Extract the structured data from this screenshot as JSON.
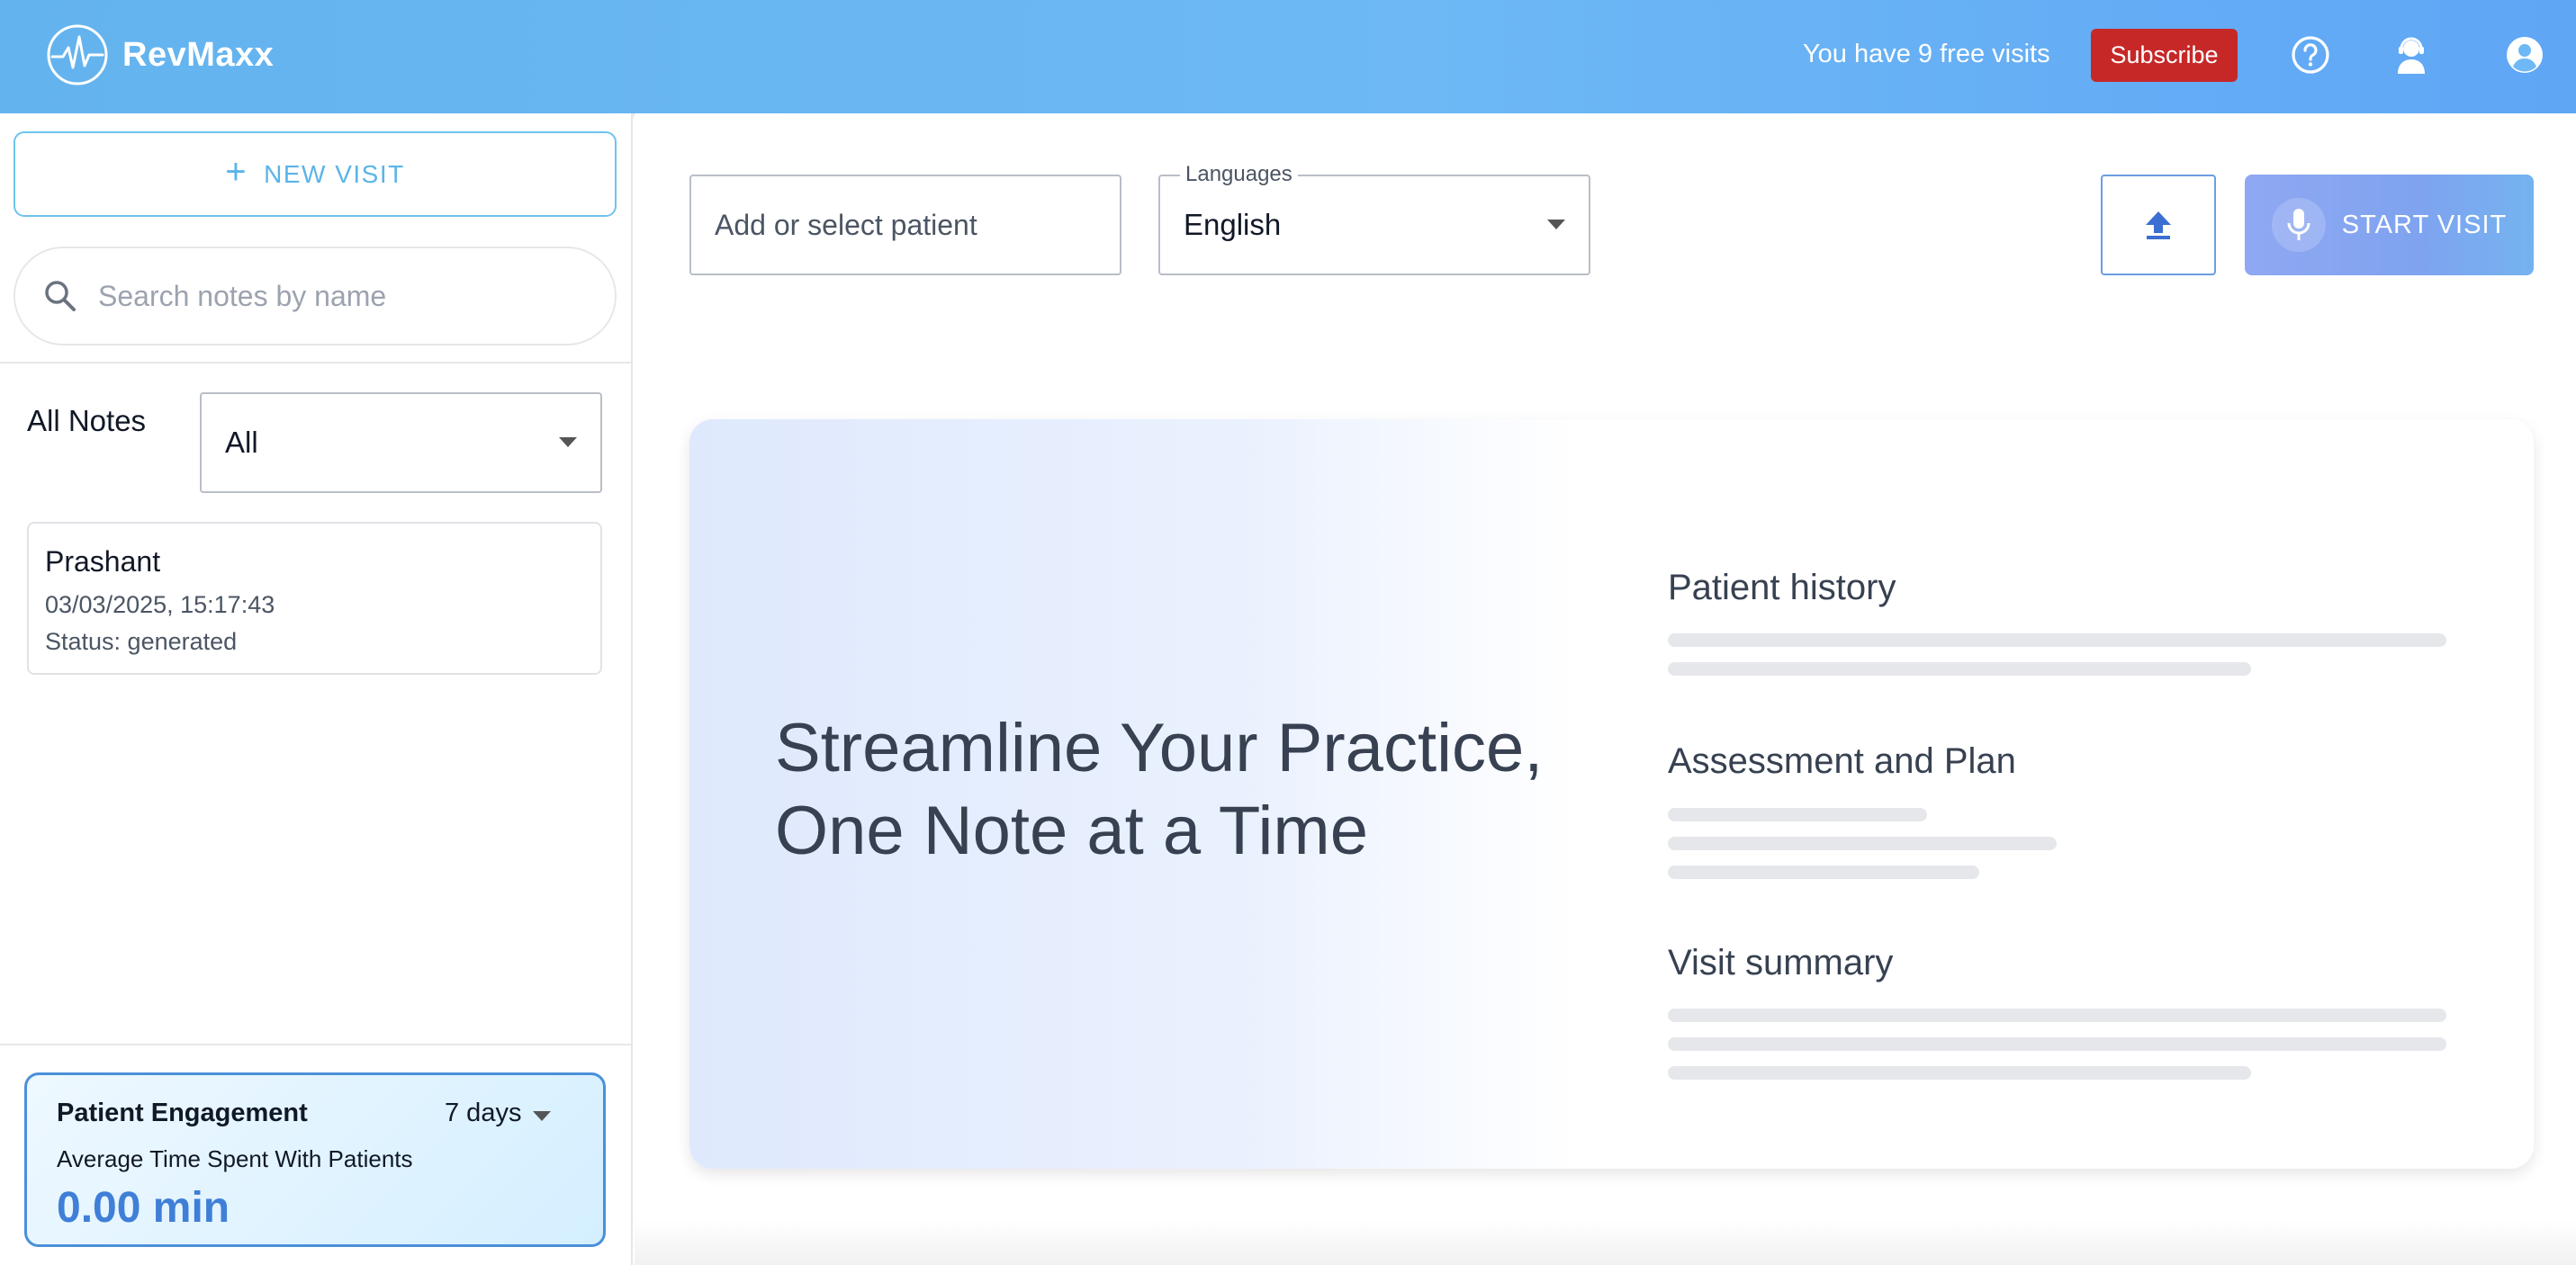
{
  "header": {
    "brand": "RevMaxx",
    "free_visits_text": "You have 9 free visits",
    "subscribe_label": "Subscribe",
    "icons": [
      "help-icon",
      "support-agent-icon",
      "account-icon"
    ]
  },
  "sidebar": {
    "new_visit_label": "NEW VISIT",
    "search_placeholder": "Search notes by name",
    "filter_label": "All Notes",
    "filter_value": "All",
    "notes": [
      {
        "name": "Prashant",
        "date": "03/03/2025, 15:17:43",
        "status": "Status: generated"
      }
    ],
    "engagement": {
      "title": "Patient Engagement",
      "range": "7 days",
      "subtitle": "Average Time Spent With Patients",
      "value": "0.00 min"
    }
  },
  "main": {
    "patient_placeholder": "Add or select patient",
    "languages_label": "Languages",
    "language_value": "English",
    "start_visit_label": "START VISIT",
    "hero": {
      "heading_line1": "Streamline Your Practice,",
      "heading_line2": "One Note at a Time",
      "sections": [
        "Patient history",
        "Assessment and Plan",
        "Visit summary"
      ]
    }
  },
  "colors": {
    "header_bg": "#6db8f5",
    "subscribe_bg": "#c62828",
    "accent_blue": "#3f7fd8",
    "new_visit_border": "#6ec3ee"
  }
}
